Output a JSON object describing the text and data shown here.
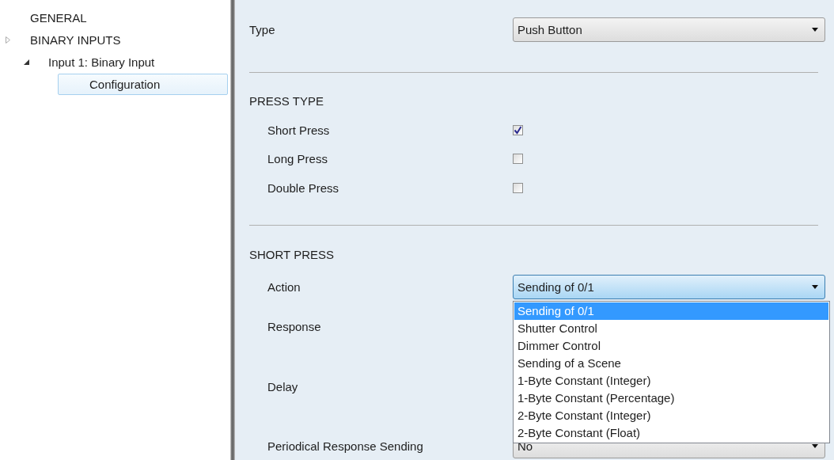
{
  "sidebar": {
    "items": [
      {
        "label": "GENERAL",
        "selected": false
      },
      {
        "label": "BINARY INPUTS",
        "selected": false,
        "expanded": false,
        "children": [
          {
            "label": "Input 1: Binary Input",
            "selected": false,
            "expanded": true,
            "children": [
              {
                "label": "Configuration",
                "selected": true
              }
            ]
          }
        ]
      }
    ]
  },
  "type_row": {
    "label": "Type",
    "value": "Push Button"
  },
  "press_type": {
    "title": "PRESS TYPE",
    "options": [
      {
        "label": "Short Press",
        "checked": true
      },
      {
        "label": "Long Press",
        "checked": false
      },
      {
        "label": "Double Press",
        "checked": false
      }
    ]
  },
  "short_press": {
    "title": "SHORT PRESS",
    "rows": [
      {
        "label": "Action",
        "kind": "select",
        "value": "Sending of 0/1",
        "open": true,
        "options": [
          {
            "label": "Sending of 0/1",
            "selected": true
          },
          {
            "label": "Shutter Control",
            "selected": false
          },
          {
            "label": "Dimmer Control",
            "selected": false
          },
          {
            "label": "Sending of a Scene",
            "selected": false
          },
          {
            "label": "1-Byte Constant (Integer)",
            "selected": false
          },
          {
            "label": "1-Byte Constant (Percentage)",
            "selected": false
          },
          {
            "label": "2-Byte Constant (Integer)",
            "selected": false
          },
          {
            "label": "2-Byte Constant (Float)",
            "selected": false
          }
        ]
      },
      {
        "label": "Response",
        "kind": "label"
      },
      {
        "label": "Delay",
        "kind": "label"
      },
      {
        "label": "Periodical Response Sending",
        "kind": "select",
        "value": "No",
        "open": false
      }
    ]
  }
}
